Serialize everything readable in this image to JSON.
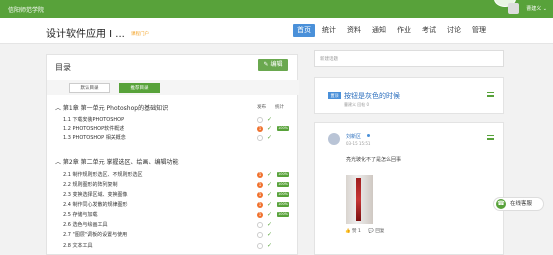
{
  "topbar": {
    "school": "信阳师范学院",
    "user": "曹建义 ⌄"
  },
  "header": {
    "course_title": "设计软件应用 I ...",
    "portal_link": "课程门户",
    "nav": [
      "首页",
      "统计",
      "资料",
      "通知",
      "作业",
      "考试",
      "讨论",
      "管理"
    ],
    "active_nav": "首页"
  },
  "outline": {
    "title": "目录",
    "edit_label": "编辑",
    "tabs": [
      "默认目录",
      "推荐目录"
    ],
    "col_status": "发布",
    "col_stats": "统计",
    "chapters": [
      {
        "title": "第1章 第一单元 Photoshop的基础知识",
        "lessons": [
          {
            "label": "1.1  下载安装PHOTOSHOP",
            "dot": "",
            "check": true,
            "pct": ""
          },
          {
            "label": "1.2  PHOTOSHOP软件概述",
            "dot": "1",
            "check": true,
            "pct": "100%"
          },
          {
            "label": "1.3  PHOTOSHOP 相关概念",
            "dot": "",
            "check": true,
            "pct": ""
          }
        ]
      },
      {
        "title": "第2章 第二单元 掌握选区、绘画、编辑功能",
        "lessons": [
          {
            "label": "2.1  制作规则形选区、不规则形选区",
            "dot": "1",
            "check": true,
            "pct": "100%"
          },
          {
            "label": "2.2  规则图形的阵列复制",
            "dot": "1",
            "check": true,
            "pct": "100%"
          },
          {
            "label": "2.3  变换选择区域、变换图像",
            "dot": "1",
            "check": true,
            "pct": "100%"
          },
          {
            "label": "2.4  制作同心发散的规律图形",
            "dot": "1",
            "check": true,
            "pct": "100%"
          },
          {
            "label": "2.5  存储与加载",
            "dot": "1",
            "check": true,
            "pct": "100%"
          },
          {
            "label": "2.6  选色与绘画工具",
            "dot": "",
            "check": true,
            "pct": ""
          },
          {
            "label": "2.7  \"图层\"调板的设置与使用",
            "dot": "",
            "check": true,
            "pct": ""
          },
          {
            "label": "2.8  文本工具",
            "dot": "",
            "check": true,
            "pct": ""
          }
        ]
      }
    ]
  },
  "discussion": {
    "new_topic_placeholder": "新建话题",
    "pinned": {
      "tag": "置顶",
      "title": "按钮是灰色的时候",
      "meta": "曹建义    回帖 0"
    },
    "post": {
      "author": "刘新区",
      "time": "03-15 15:51",
      "text": "亮光玻化不了是怎么回事",
      "likes": "赞 1",
      "reply": "回复"
    }
  },
  "online_service": "在线客服",
  "colors": {
    "brand_green": "#58a23a",
    "nav_active_blue": "#4a90d9",
    "dot_orange": "#f0722f"
  }
}
